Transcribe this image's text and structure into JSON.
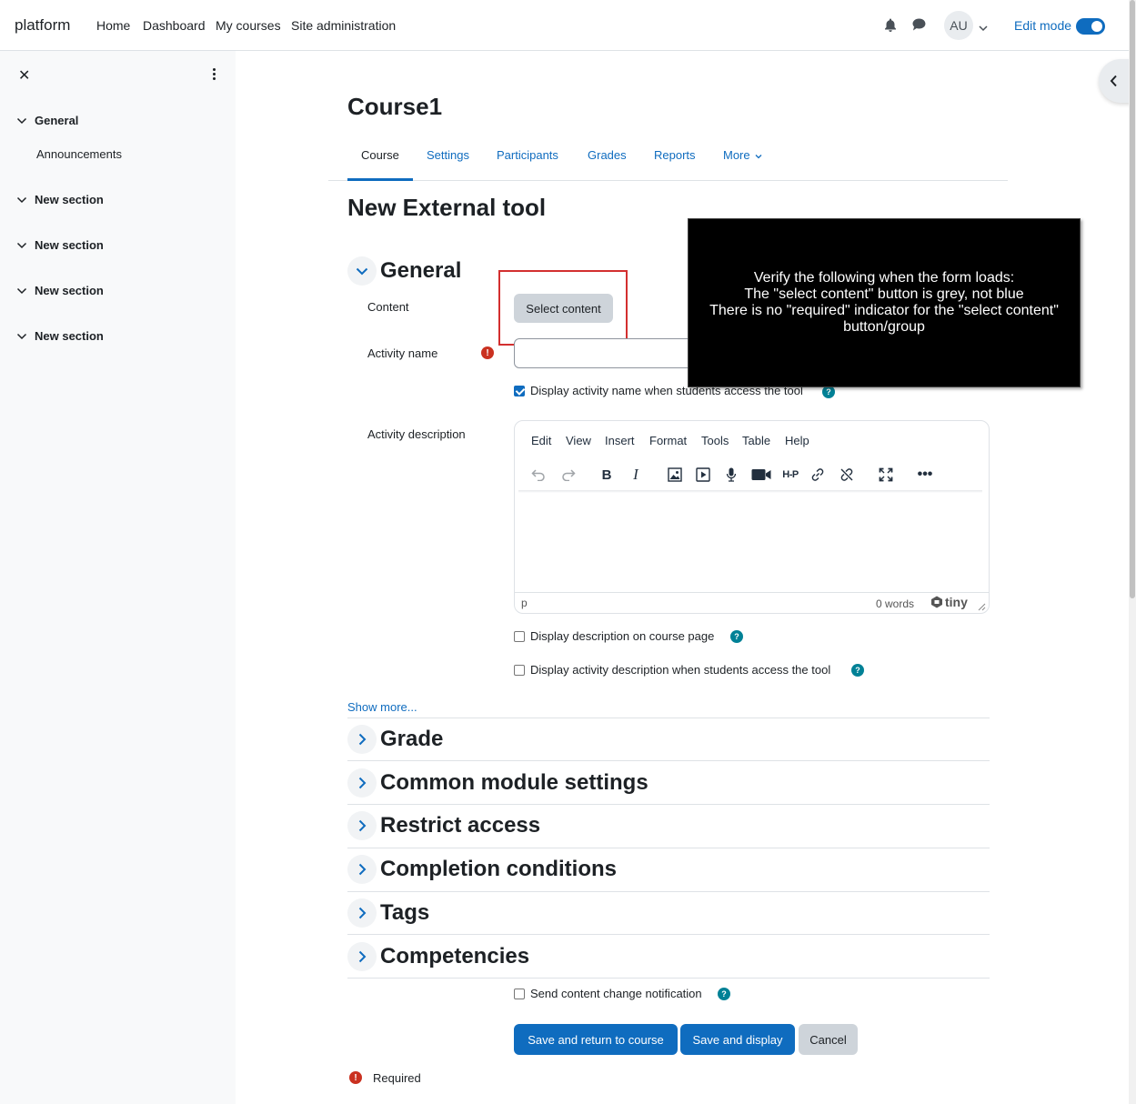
{
  "navbar": {
    "brand": "platform",
    "links": [
      "Home",
      "Dashboard",
      "My courses",
      "Site administration"
    ],
    "avatar": "AU",
    "edit_mode_label": "Edit mode"
  },
  "drawer": {
    "sections": [
      "General",
      "New section",
      "New section",
      "New section",
      "New section"
    ],
    "sub_item": "Announcements"
  },
  "course": {
    "title": "Course1",
    "tabs": [
      "Course",
      "Settings",
      "Participants",
      "Grades",
      "Reports",
      "More"
    ]
  },
  "page": {
    "title": "New External tool"
  },
  "form": {
    "general_title": "General",
    "content_label": "Content",
    "select_content_button": "Select content",
    "activity_name_label": "Activity name",
    "display_name_checkbox": "Display activity name when students access the tool",
    "activity_description_label": "Activity description",
    "editor": {
      "menu": [
        "Edit",
        "View",
        "Insert",
        "Format",
        "Tools",
        "Table",
        "Help"
      ],
      "status_path": "p",
      "word_count": "0 words",
      "brand": "tiny"
    },
    "display_desc_checkbox": "Display description on course page",
    "display_activity_desc_checkbox": "Display activity description when students access the tool",
    "show_more": "Show more...",
    "sections": [
      "Grade",
      "Common module settings",
      "Restrict access",
      "Completion conditions",
      "Tags",
      "Competencies"
    ],
    "notification_checkbox": "Send content change notification",
    "buttons": {
      "save_return": "Save and return to course",
      "save_display": "Save and display",
      "cancel": "Cancel"
    },
    "required_label": "Required"
  },
  "overlay": {
    "lines": [
      "Verify the following when the form loads:",
      "The \"select content\" button is grey, not blue",
      "There is no \"required\" indicator for the \"select content\" button/group"
    ]
  },
  "colors": {
    "primary": "#0f6cbf",
    "required": "#ca3120",
    "help": "#008196",
    "highlight": "#d32f2f"
  }
}
